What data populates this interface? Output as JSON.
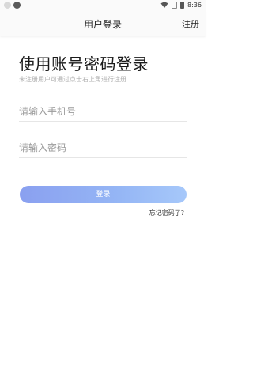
{
  "status_bar": {
    "time": "8:36"
  },
  "nav": {
    "title": "用户登录",
    "register_label": "注册"
  },
  "main": {
    "heading": "使用账号密码登录",
    "subheading": "未注册用户可通过点击右上角进行注册",
    "phone_placeholder": "请输入手机号",
    "password_placeholder": "请输入密码",
    "login_label": "登录",
    "forgot_label": "忘记密码了?"
  },
  "colors": {
    "button_gradient_start": "#8aa0f0",
    "button_gradient_end": "#a6c8fa"
  }
}
